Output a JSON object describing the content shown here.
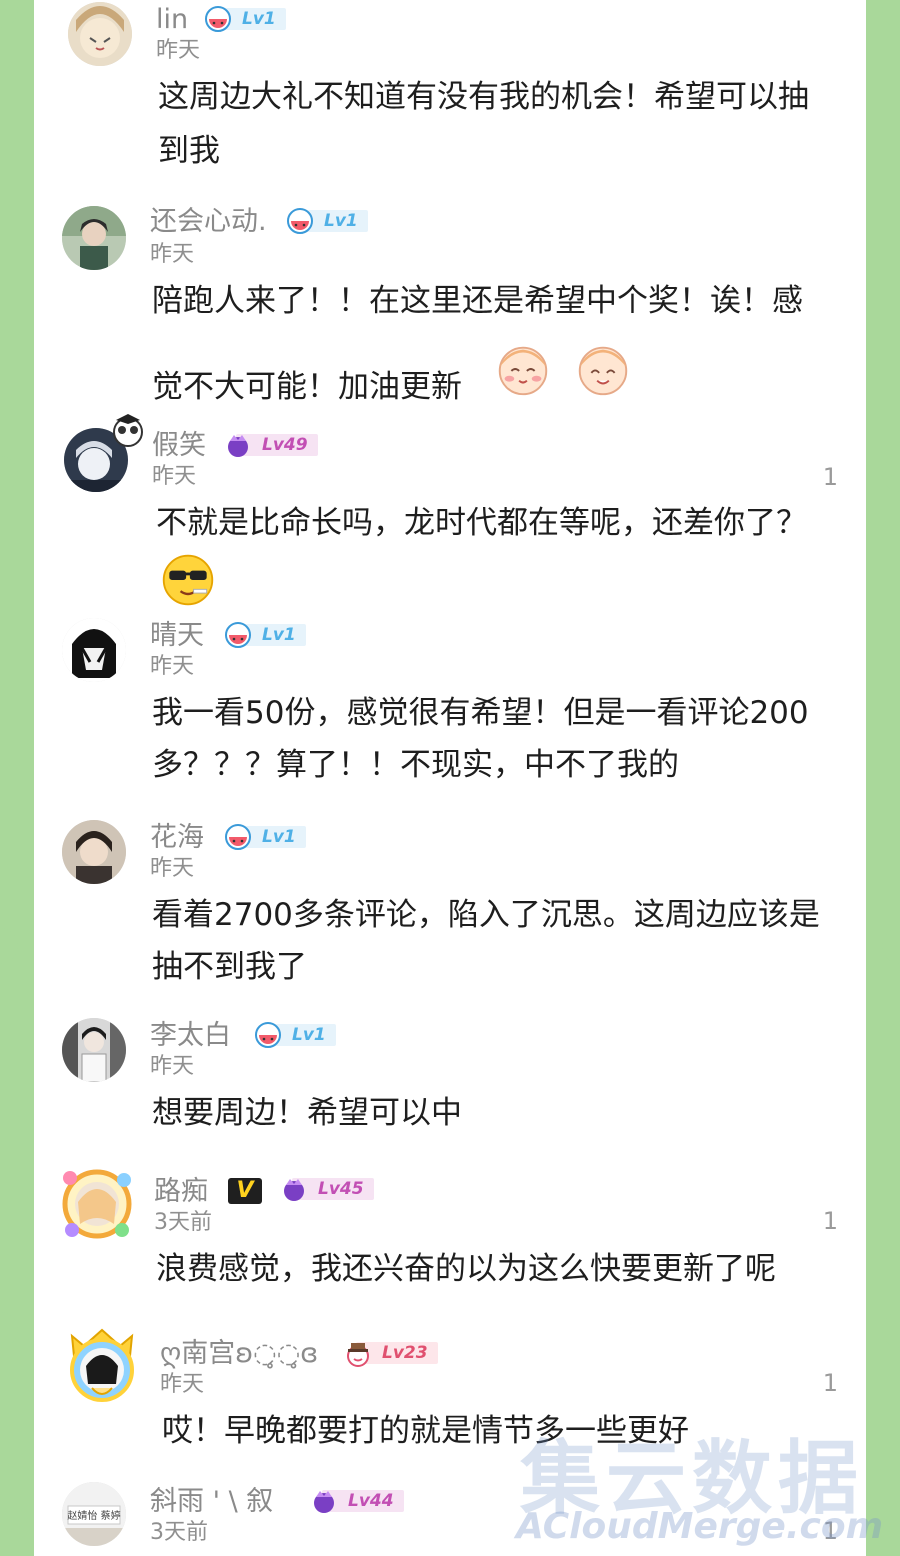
{
  "comments": [
    {
      "name": "lin",
      "level": "Lv1",
      "time": "昨天",
      "likes": "",
      "lines": [
        "这周边大礼不知道有没有我的机会！希望可以抽",
        "到我"
      ]
    },
    {
      "name": "还会心动.",
      "level": "Lv1",
      "time": "昨天",
      "likes": "",
      "lines": [
        "陪跑人来了！！在这里还是希望中个奖！诶！感",
        "觉不大可能！加油更新"
      ]
    },
    {
      "name": "假笑",
      "level": "Lv49",
      "time": "昨天",
      "likes": "1",
      "lines": [
        "不就是比命长吗，龙时代都在等呢，还差你了？"
      ]
    },
    {
      "name": "晴天",
      "level": "Lv1",
      "time": "昨天",
      "likes": "",
      "lines": [
        "我一看50份，感觉很有希望！但是一看评论200",
        "多？？？算了！！不现实，中不了我的"
      ]
    },
    {
      "name": "花海",
      "level": "Lv1",
      "time": "昨天",
      "likes": "",
      "lines": [
        "看着2700多条评论，陷入了沉思。这周边应该是",
        "抽不到我了"
      ]
    },
    {
      "name": "李太白",
      "level": "Lv1",
      "time": "昨天",
      "likes": "",
      "lines": [
        "想要周边！希望可以中"
      ]
    },
    {
      "name": "路痴",
      "vip": "V",
      "level": "Lv45",
      "time": "3天前",
      "likes": "1",
      "lines": [
        "浪费感觉，我还兴奋的以为这么快要更新了呢"
      ]
    },
    {
      "name": "ღ南宫ʚ◌̥◌̥ɞ",
      "level": "Lv23",
      "time": "昨天",
      "likes": "1",
      "lines": [
        "哎！早晚都要打的就是情节多一些更好"
      ]
    },
    {
      "name": "斜雨 ' \\ 叙",
      "level": "Lv44",
      "time": "3天前",
      "likes": "1",
      "lines": []
    }
  ],
  "avatar_texts": {
    "c8": "赵婧怡 蔡婷"
  },
  "watermark": {
    "cn": "集云数据",
    "en": "ACloudMerge.com"
  },
  "colors": {
    "background": "#a9d89a",
    "panel": "#ffffff",
    "lv_low": "#4fb0e6",
    "lv_high": "#c24fb4",
    "lv_mid": "#e0506f"
  }
}
